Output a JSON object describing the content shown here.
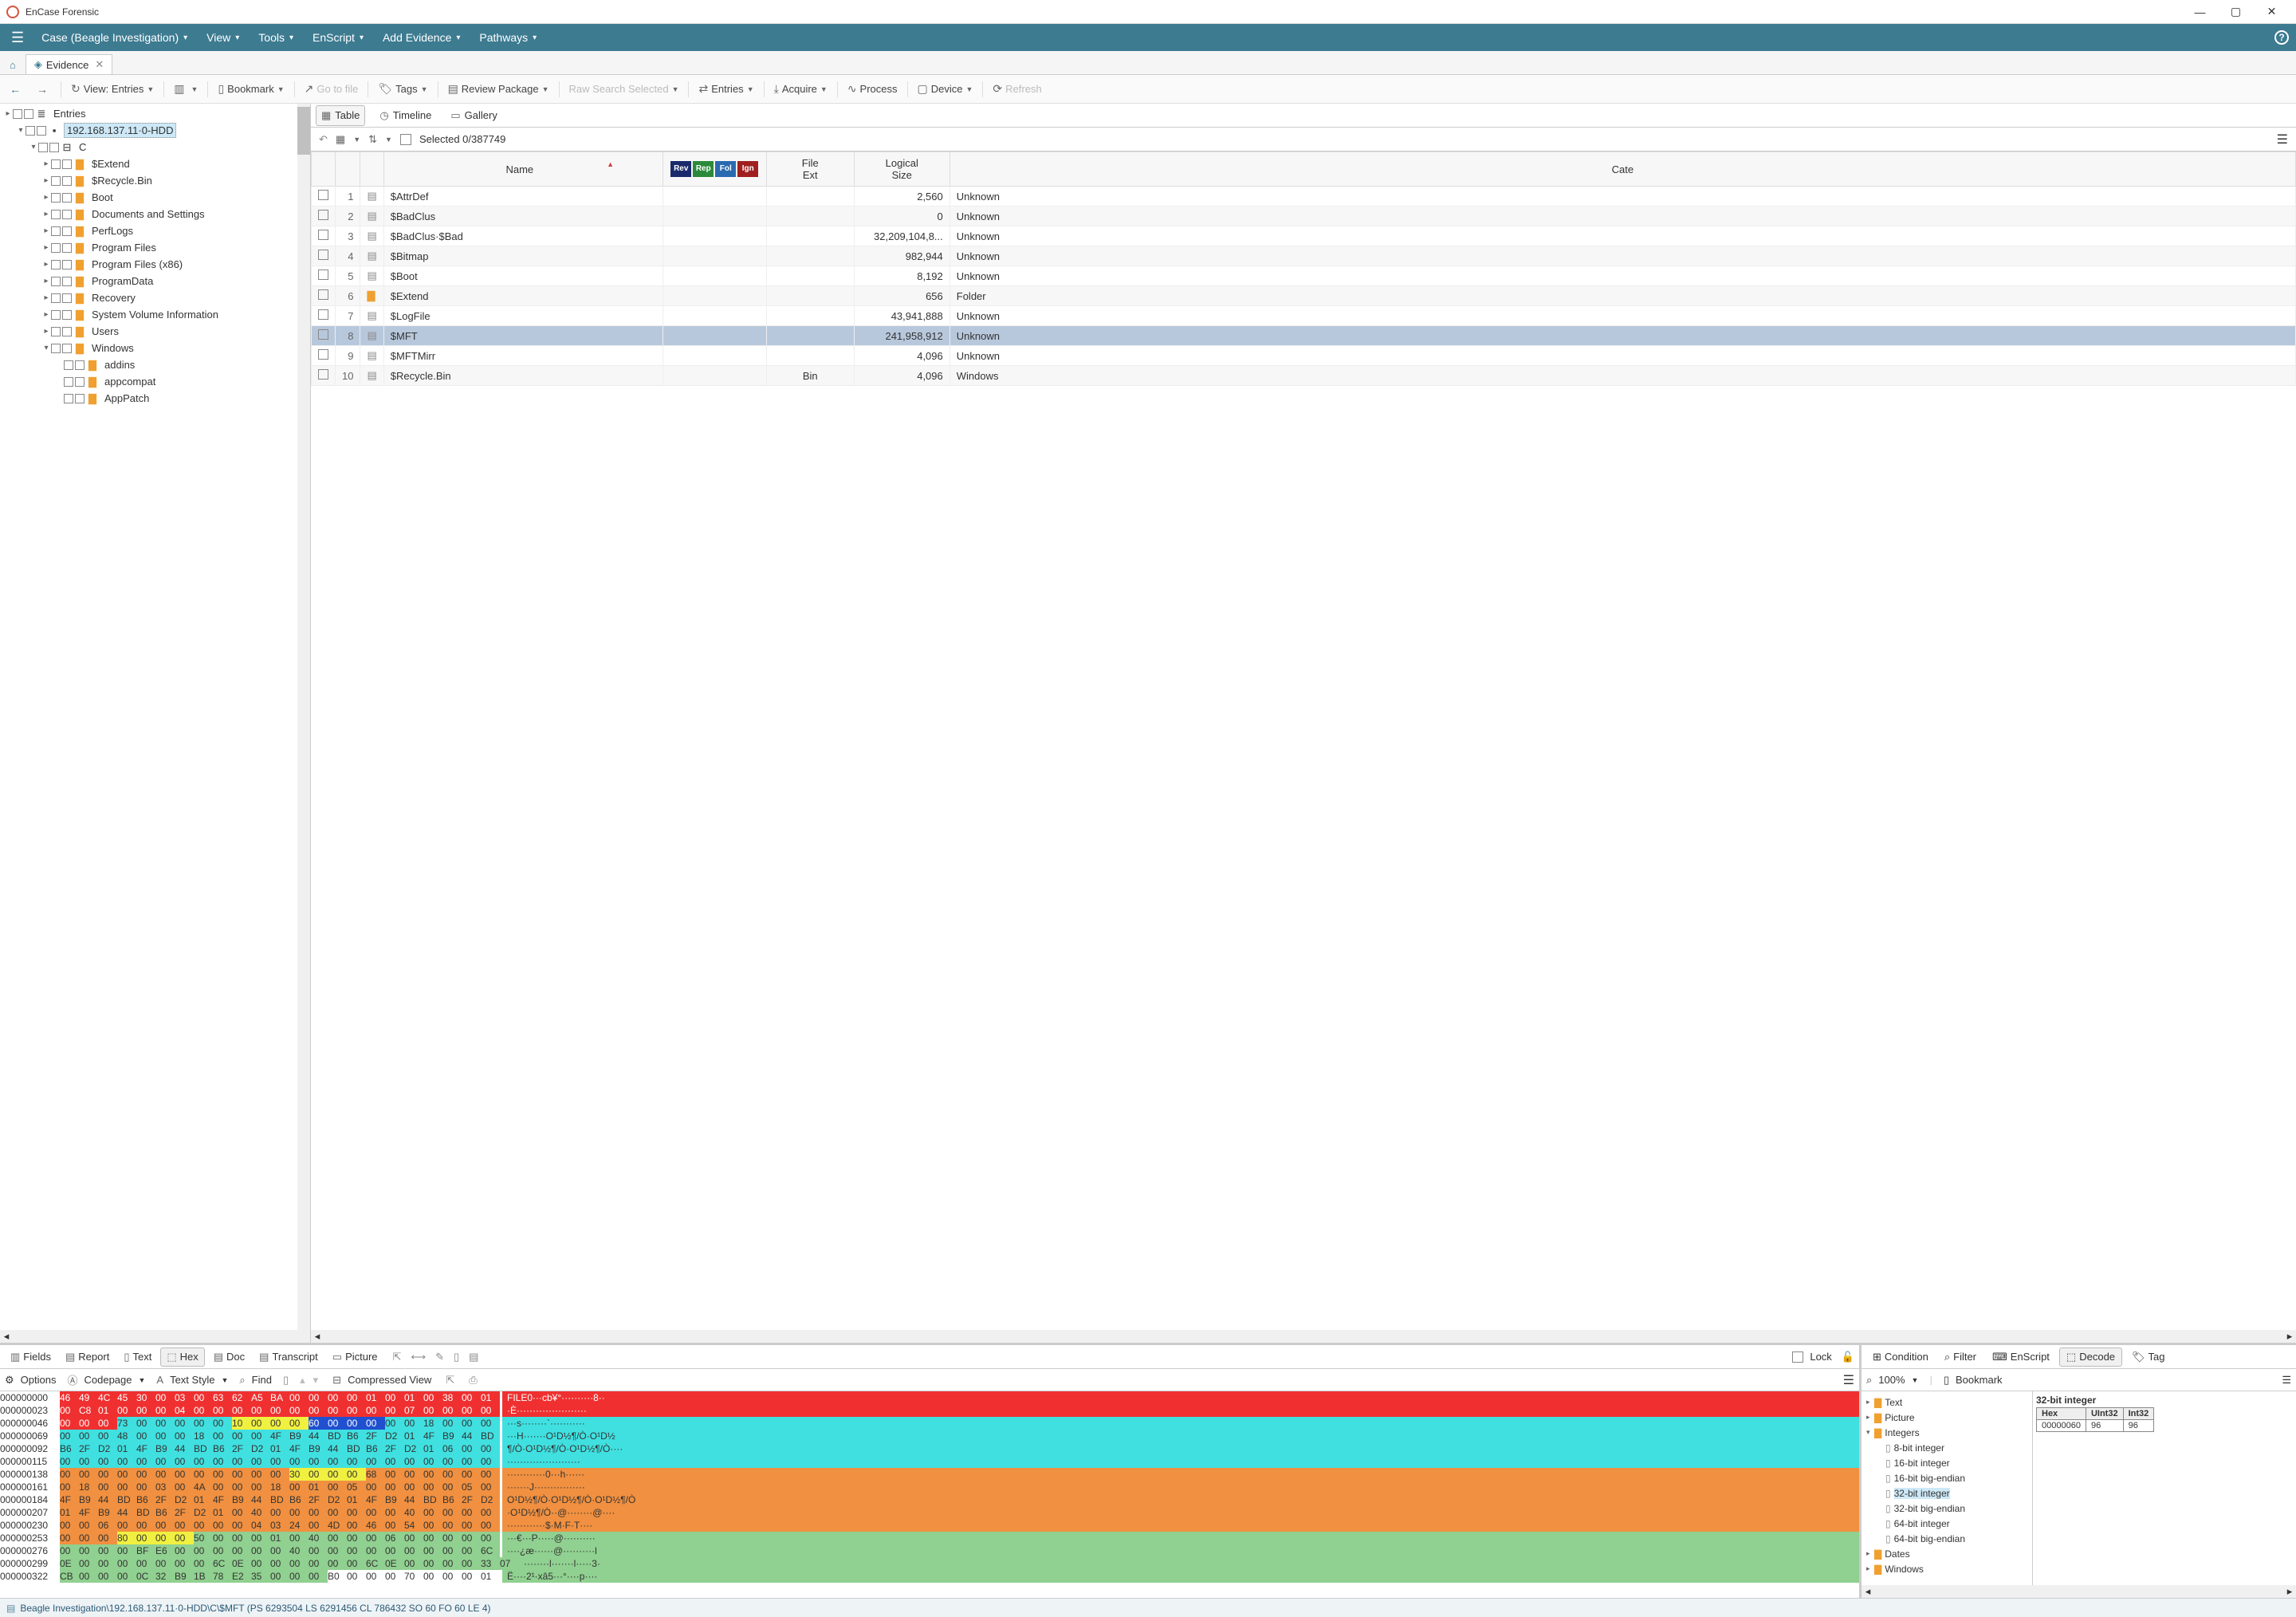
{
  "app": {
    "title": "EnCase Forensic"
  },
  "menu": {
    "items": [
      "Case (Beagle Investigation)",
      "View",
      "Tools",
      "EnScript",
      "Add Evidence",
      "Pathways"
    ]
  },
  "tabs": {
    "evidence": "Evidence"
  },
  "toolbar": {
    "view": "View: Entries",
    "bookmark": "Bookmark",
    "gotofile": "Go to file",
    "tags": "Tags",
    "review": "Review Package",
    "rawsearch": "Raw Search Selected",
    "entries": "Entries",
    "acquire": "Acquire",
    "process": "Process",
    "device": "Device",
    "refresh": "Refresh"
  },
  "tree": {
    "root": "Entries",
    "device": "192.168.137.11·0-HDD",
    "volume": "C",
    "folders": [
      "$Extend",
      "$Recycle.Bin",
      "Boot",
      "Documents and Settings",
      "PerfLogs",
      "Program Files",
      "Program Files (x86)",
      "ProgramData",
      "Recovery",
      "System Volume Information",
      "Users",
      "Windows"
    ],
    "winsubs": [
      "addins",
      "appcompat",
      "AppPatch"
    ]
  },
  "viewtabs": {
    "table": "Table",
    "timeline": "Timeline",
    "gallery": "Gallery"
  },
  "selbar": {
    "text": "Selected 0/387749"
  },
  "grid": {
    "headers": {
      "name": "Name",
      "ext": "File\nExt",
      "size": "Logical\nSize",
      "cat": "Cate"
    },
    "badges": [
      "Rev",
      "Rep",
      "Fol",
      "Ign"
    ],
    "rows": [
      {
        "n": 1,
        "name": "$AttrDef",
        "ext": "",
        "size": "2,560",
        "cat": "Unknown"
      },
      {
        "n": 2,
        "name": "$BadClus",
        "ext": "",
        "size": "0",
        "cat": "Unknown"
      },
      {
        "n": 3,
        "name": "$BadClus·$Bad",
        "ext": "",
        "size": "32,209,104,8...",
        "cat": "Unknown"
      },
      {
        "n": 4,
        "name": "$Bitmap",
        "ext": "",
        "size": "982,944",
        "cat": "Unknown"
      },
      {
        "n": 5,
        "name": "$Boot",
        "ext": "",
        "size": "8,192",
        "cat": "Unknown"
      },
      {
        "n": 6,
        "name": "$Extend",
        "ext": "",
        "size": "656",
        "cat": "Folder",
        "folder": true
      },
      {
        "n": 7,
        "name": "$LogFile",
        "ext": "",
        "size": "43,941,888",
        "cat": "Unknown"
      },
      {
        "n": 8,
        "name": "$MFT",
        "ext": "",
        "size": "241,958,912",
        "cat": "Unknown",
        "sel": true
      },
      {
        "n": 9,
        "name": "$MFTMirr",
        "ext": "",
        "size": "4,096",
        "cat": "Unknown"
      },
      {
        "n": 10,
        "name": "$Recycle.Bin",
        "ext": "Bin",
        "size": "4,096",
        "cat": "Windows"
      }
    ]
  },
  "bottomtabs": [
    "Fields",
    "Report",
    "Text",
    "Hex",
    "Doc",
    "Transcript",
    "Picture"
  ],
  "bottomright": {
    "lock": "Lock"
  },
  "hexopts": {
    "options": "Options",
    "codepage": "Codepage",
    "textstyle": "Text Style",
    "find": "Find",
    "compressed": "Compressed View"
  },
  "hex": {
    "rows": [
      {
        "off": "000000000",
        "cls": "c-red",
        "bytes": "46 49 4C 45 30 00 03 00 63 62 A5 BA 00 00 00 00 01 00 01 00 38 00 01",
        "asc": "FILE0···cb¥°··········8··"
      },
      {
        "off": "000000023",
        "cls": "c-red",
        "bytes": "00 C8 01 00 00 00 04 00 00 00 00 00 00 00 00 00 00 00 07 00 00 00 00",
        "asc": "·È······················"
      },
      {
        "off": "000000046",
        "cls": "c-cyan",
        "bytes": "00 00 00 73 00 00 00 00 00 10 00 00 00 60 00 00 00 00 00 18 00 00 00",
        "asc": "···s········`···········",
        "spans": [
          {
            "s": 9,
            "e": 13,
            "c": "c-yellow"
          },
          {
            "s": 13,
            "e": 17,
            "c": "c-blue"
          }
        ],
        "prefcls": "c-red",
        "pref": 3
      },
      {
        "off": "000000069",
        "cls": "c-cyan",
        "bytes": "00 00 00 48 00 00 00 18 00 00 00 4F B9 44 BD B6 2F D2 01 4F B9 44 BD",
        "asc": "···H·······O¹D½¶/Ò·O¹D½"
      },
      {
        "off": "000000092",
        "cls": "c-cyan",
        "bytes": "B6 2F D2 01 4F B9 44 BD B6 2F D2 01 4F B9 44 BD B6 2F D2 01 06 00 00",
        "asc": "¶/Ò·O¹D½¶/Ò·O¹D½¶/Ò····"
      },
      {
        "off": "000000115",
        "cls": "c-cyan",
        "bytes": "00 00 00 00 00 00 00 00 00 00 00 00 00 00 00 00 00 00 00 00 00 00 00",
        "asc": "·······················"
      },
      {
        "off": "000000138",
        "cls": "c-orange",
        "bytes": "00 00 00 00 00 00 00 00 00 00 00 00 30 00 00 00 68 00 00 00 00 00 00",
        "asc": "············0···h······",
        "spans": [
          {
            "s": 12,
            "e": 16,
            "c": "c-yellow"
          }
        ]
      },
      {
        "off": "000000161",
        "cls": "c-orange",
        "bytes": "00 18 00 00 00 03 00 4A 00 00 00 18 00 01 00 05 00 00 00 00 00 05 00",
        "asc": "·······J················"
      },
      {
        "off": "000000184",
        "cls": "c-orange",
        "bytes": "4F B9 44 BD B6 2F D2 01 4F B9 44 BD B6 2F D2 01 4F B9 44 BD B6 2F D2",
        "asc": "O¹D½¶/Ò·O¹D½¶/Ò·O¹D½¶/Ò"
      },
      {
        "off": "000000207",
        "cls": "c-orange",
        "bytes": "01 4F B9 44 BD B6 2F D2 01 00 40 00 00 00 00 00 00 00 40 00 00 00 00",
        "asc": "·O¹D½¶/Ò··@········@····"
      },
      {
        "off": "000000230",
        "cls": "c-orange",
        "bytes": "00 00 06 00 00 00 00 00 00 00 04 03 24 00 4D 00 46 00 54 00 00 00 00",
        "asc": "············$·M·F·T····"
      },
      {
        "off": "000000253",
        "cls": "c-green",
        "bytes": "00 00 00 80 00 00 00 50 00 00 00 01 00 40 00 00 00 06 00 00 00 00 00",
        "asc": "···€···P·····@··········",
        "spans": [
          {
            "s": 3,
            "e": 7,
            "c": "c-yellow"
          }
        ],
        "prefcls": "c-orange",
        "pref": 3
      },
      {
        "off": "000000276",
        "cls": "c-green",
        "bytes": "00 00 00 00 BF E6 00 00 00 00 00 00 40 00 00 00 00 00 00 00 00 00 6C",
        "asc": "····¿æ······@··········l"
      },
      {
        "off": "000000299",
        "cls": "c-green",
        "bytes": "0E 00 00 00 00 00 00 00 6C 0E 00 00 00 00 00 00 6C 0E 00 00 00 00 33 07",
        "asc": "········l·······l·····3·"
      },
      {
        "off": "000000322",
        "cls": "c-green",
        "bytes": "CB 00 00 00 0C 32 B9 1B 78 E2 35 00 00 00 B0 00 00 00 70 00 00 00 01",
        "asc": "Ë····2¹·xâ5···°····p····",
        "spans": [
          {
            "s": 14,
            "e": 23,
            "c": "c-white"
          }
        ]
      }
    ]
  },
  "dectabs": [
    "Condition",
    "Filter",
    "EnScript",
    "Decode",
    "Tag"
  ],
  "decopts": {
    "zoom": "100%",
    "bookmark": "Bookmark"
  },
  "dectree": {
    "cats": [
      "Text",
      "Picture",
      "Integers",
      "Dates",
      "Windows"
    ],
    "ints": [
      "8-bit integer",
      "16-bit integer",
      "16-bit big-endian",
      "32-bit integer",
      "32-bit big-endian",
      "64-bit integer",
      "64-bit big-endian"
    ]
  },
  "decode": {
    "title": "32-bit integer",
    "headers": [
      "Hex",
      "UInt32",
      "Int32"
    ],
    "row": [
      "00000060",
      "96",
      "96"
    ]
  },
  "status": "Beagle Investigation\\192.168.137.11·0-HDD\\C\\$MFT (PS 6293504 LS 6291456 CL 786432 SO 60 FO 60 LE 4)"
}
